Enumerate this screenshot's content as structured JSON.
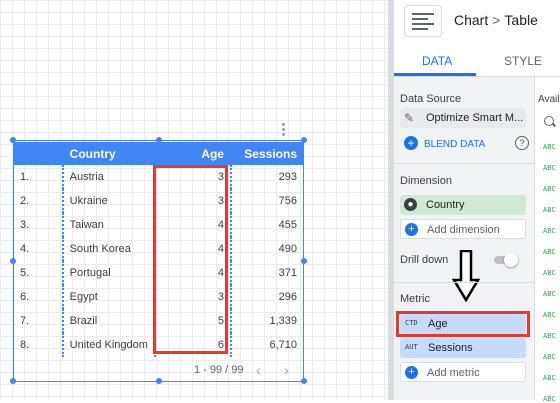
{
  "breadcrumb": {
    "parent": "Chart",
    "separator": ">",
    "current": "Table"
  },
  "tabs": [
    {
      "label": "DATA",
      "active": true
    },
    {
      "label": "STYLE",
      "active": false
    }
  ],
  "table": {
    "headers": [
      "",
      "Country",
      "Age",
      "Sessions"
    ],
    "rows": [
      [
        "1.",
        "Austria",
        "3",
        "293"
      ],
      [
        "2.",
        "Ukraine",
        "3",
        "756"
      ],
      [
        "3.",
        "Taiwan",
        "4",
        "455"
      ],
      [
        "4.",
        "South Korea",
        "4",
        "490"
      ],
      [
        "5.",
        "Portugal",
        "4",
        "371"
      ],
      [
        "6.",
        "Egypt",
        "3",
        "296"
      ],
      [
        "7.",
        "Brazil",
        "5",
        "1,339"
      ],
      [
        "8.",
        "United Kingdom",
        "6",
        "6,710"
      ]
    ],
    "pagination": "1 - 99 / 99"
  },
  "data_source": {
    "title": "Data Source",
    "name": "Optimize Smart M...",
    "blend": "BLEND DATA",
    "help": "?"
  },
  "dimension": {
    "title": "Dimension",
    "chip": "Country",
    "add": "Add dimension"
  },
  "drill_down": {
    "label": "Drill down",
    "enabled": false
  },
  "metric": {
    "title": "Metric",
    "items": [
      {
        "tag": "CTD",
        "label": "Age"
      },
      {
        "tag": "AUT",
        "label": "Sessions"
      }
    ],
    "add": "Add metric"
  },
  "available": {
    "title": "Avail",
    "field_tag": "ABC"
  },
  "colors": {
    "accent": "#4285f4",
    "highlight": "#e53935",
    "dimension": "#ceead6",
    "metric": "#c6dafc"
  }
}
